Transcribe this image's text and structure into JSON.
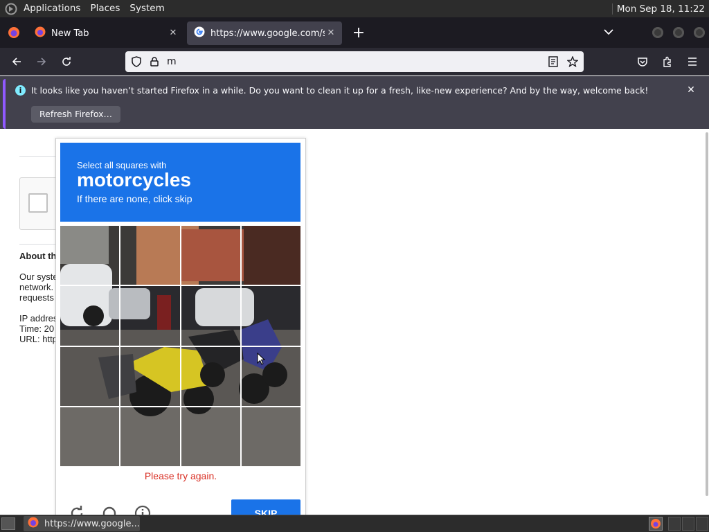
{
  "top_panel": {
    "menus": [
      "Applications",
      "Places",
      "System"
    ],
    "clock": "Mon Sep 18, 11:22"
  },
  "tabs": [
    {
      "title": "New Tab",
      "favicon": "firefox-icon"
    },
    {
      "title": "https://www.google.com/se",
      "favicon": "google-g-icon",
      "active": true
    }
  ],
  "urlbar": {
    "value": "m",
    "left_icons": [
      "shield-icon",
      "lock-icon"
    ],
    "right_icons": [
      "reader-mode-icon",
      "bookmark-star-icon"
    ]
  },
  "toolbar_icons": [
    "pocket-icon",
    "extensions-icon",
    "hamburger-menu-icon"
  ],
  "notification": {
    "message": "It looks like you haven’t started Firefox in a while. Do you want to clean it up for a fresh, like-new experience? And by the way, welcome back!",
    "button": "Refresh Firefox…"
  },
  "page": {
    "about_heading": "About th",
    "lines": [
      "Our syste",
      "network.",
      "requests",
      "IP addres",
      "Time: 20",
      "URL: http"
    ]
  },
  "captcha": {
    "instruction": "Select all squares with",
    "target": "motorcycles",
    "hint": "If there are none, click skip",
    "error": "Please try again.",
    "skip_label": "SKIP",
    "rows": 4,
    "cols": 4,
    "footer_icons": [
      "reload-icon",
      "audio-headphones-icon",
      "info-icon"
    ],
    "colors": {
      "header": "#1a73e8",
      "error": "#d93025",
      "skip": "#1a73e8"
    }
  },
  "taskbar": {
    "task_title": "https://www.google..."
  },
  "colors": {
    "panel": "#2c2c2c",
    "tab_strip": "#1c1b22",
    "nav_bar": "#2b2a33",
    "notification": "#42414d",
    "notification_accent": "#9059ff"
  }
}
